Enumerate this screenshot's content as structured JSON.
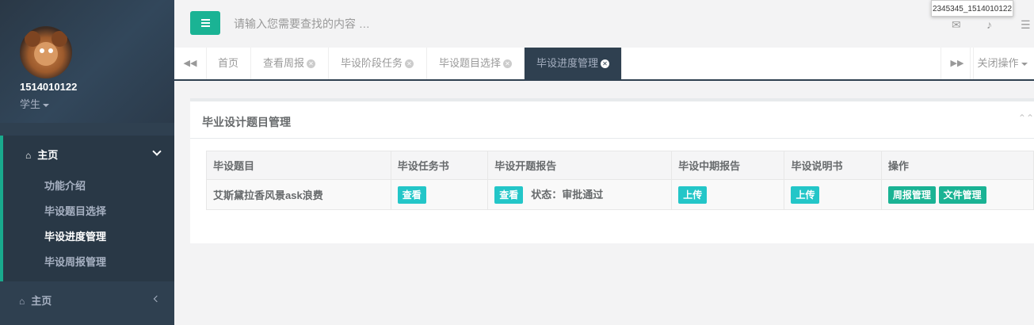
{
  "profile": {
    "username": "1514010122",
    "role": "学生"
  },
  "nav": {
    "main_label": "主页",
    "sub_items": [
      "功能介绍",
      "毕设题目选择",
      "毕设进度管理",
      "毕设周报管理"
    ],
    "bottom_label": "主页"
  },
  "header": {
    "search_placeholder": "请输入您需要查找的内容 …",
    "tooltip": "2345345_1514010122"
  },
  "tabs": [
    "首页",
    "查看周报",
    "毕设阶段任务",
    "毕设题目选择",
    "毕设进度管理"
  ],
  "close_ops_label": "关闭操作",
  "panel": {
    "title": "毕业设计题目管理",
    "headers": [
      "毕设题目",
      "毕设任务书",
      "毕设开题报告",
      "毕设中期报告",
      "毕设说明书",
      "操作"
    ],
    "row": {
      "topic": "艾斯黛拉香风景ask浪费",
      "task_btn": "查看",
      "proposal_btn": "查看",
      "proposal_status": "状态：审批通过",
      "midterm_btn": "上传",
      "spec_btn": "上传",
      "weekly_btn": "周报管理",
      "file_btn": "文件管理"
    }
  },
  "colors": {
    "sidebar": "#2f4050",
    "accent": "#1ab394",
    "info": "#23c6c8"
  }
}
